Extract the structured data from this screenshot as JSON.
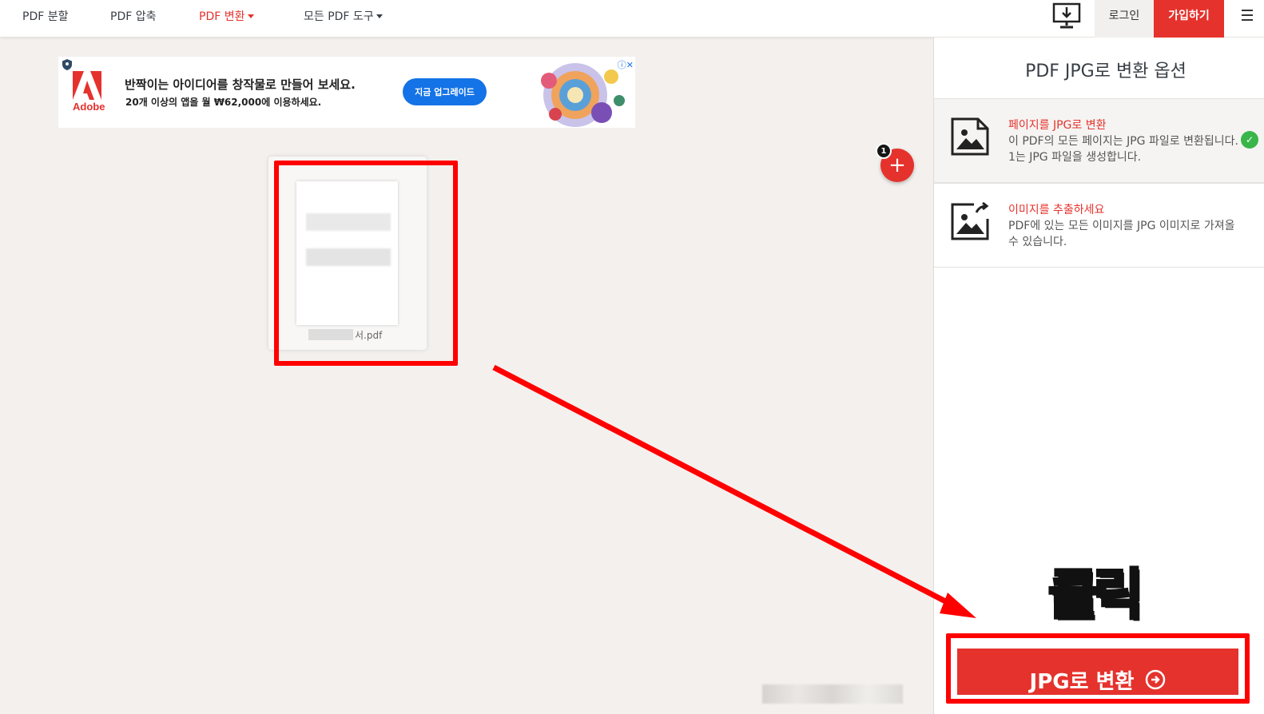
{
  "nav": {
    "items": [
      {
        "label": "PDF 분할",
        "active": false,
        "dropdown": false
      },
      {
        "label": "PDF 압축",
        "active": false,
        "dropdown": false
      },
      {
        "label": "PDF 변환",
        "active": true,
        "dropdown": true
      },
      {
        "label": "모든 PDF 도구",
        "active": false,
        "dropdown": true
      }
    ],
    "login_label": "로그인",
    "signup_label": "가입하기",
    "desktop_icon": "desktop-download-icon",
    "menu_icon": "hamburger-menu-icon"
  },
  "ad": {
    "brand": "Adobe",
    "headline": "반짝이는 아이디어를 창작물로 만들어 보세요.",
    "subline": "20개 이상의 앱을 월 ₩62,000에 이용하세요.",
    "cta_label": "지금 업그레이드",
    "close_label": "ⓘ✕"
  },
  "file": {
    "name_suffix": "서.pdf"
  },
  "add": {
    "count": "1",
    "label": "+"
  },
  "panel": {
    "title": "PDF JPG로 변환 옵션",
    "options": [
      {
        "title": "페이지를 JPG로 변환",
        "description": "이 PDF의 모든 페이지는 JPG 파일로 변환됩니다. 1는 JPG 파일을 생성합니다.",
        "selected": true,
        "icon": "image-page-icon"
      },
      {
        "title": "이미지를 추출하세요",
        "description": "PDF에 있는 모든 이미지를 JPG 이미지로 가져올 수 있습니다.",
        "selected": false,
        "icon": "image-extract-icon"
      }
    ],
    "convert_label": "JPG로 변환"
  },
  "annotation": {
    "click_text": "클릭",
    "color": "#ff0000"
  },
  "colors": {
    "brand_red": "#e5322d",
    "background": "#f3f0ed",
    "check_green": "#39b54a"
  }
}
